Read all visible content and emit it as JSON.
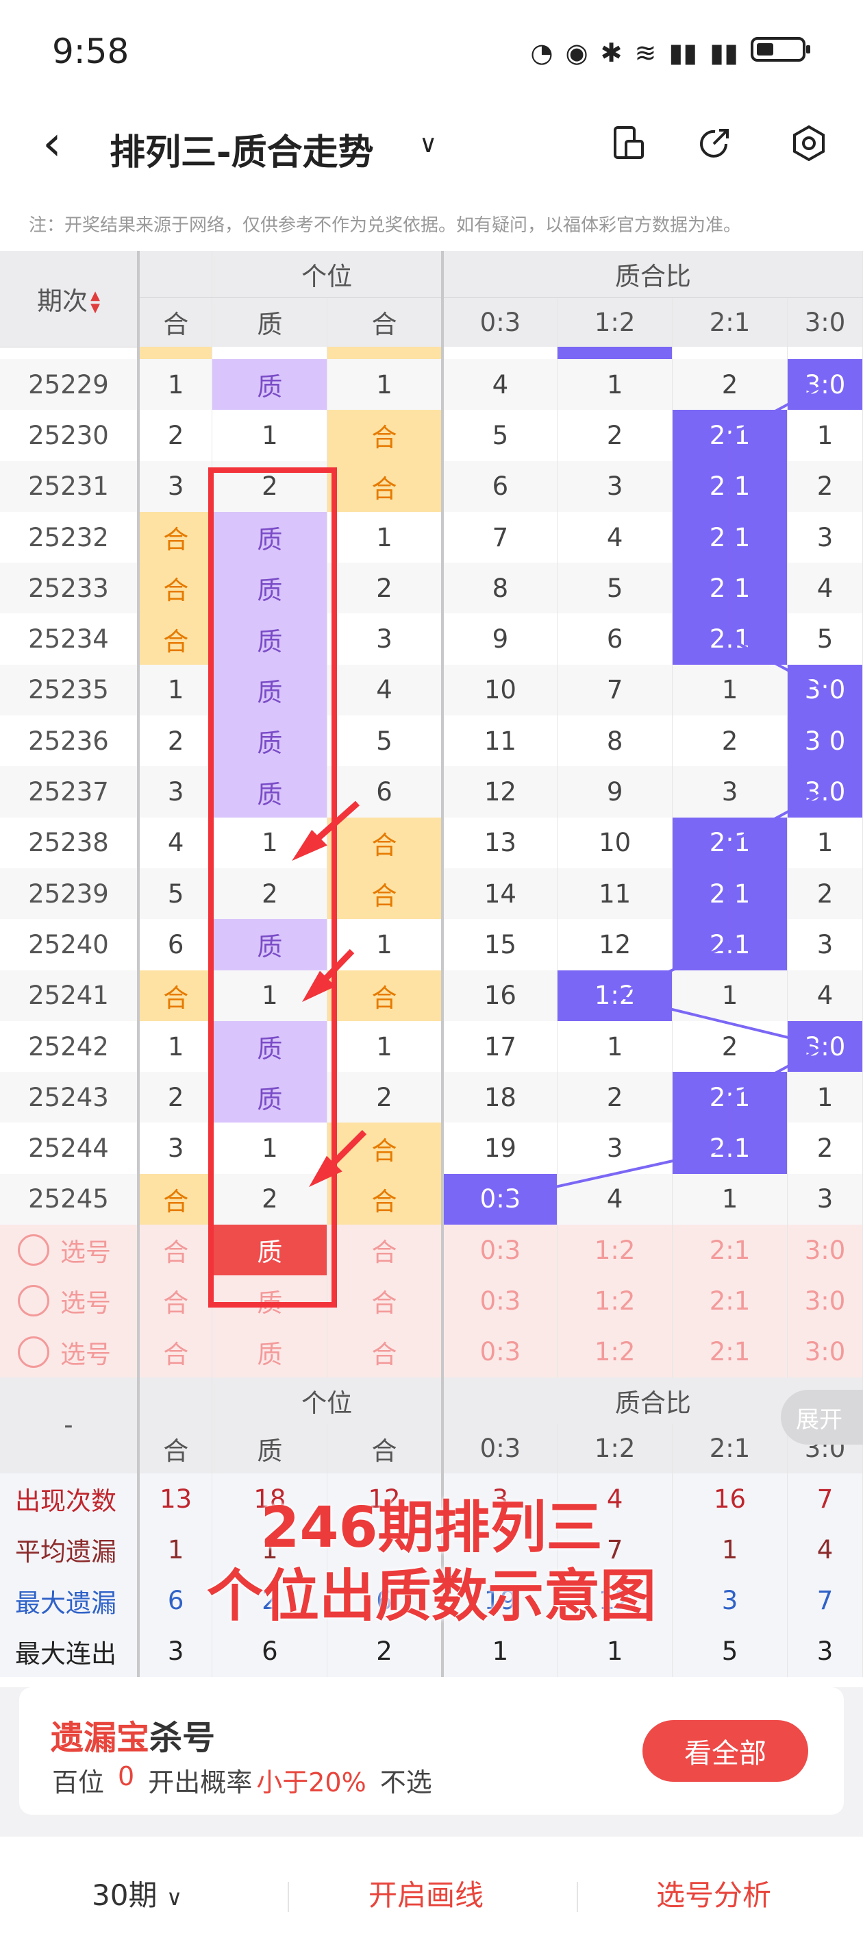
{
  "status_bar": {
    "time": "9:58"
  },
  "header": {
    "title": "排列三-质合走势"
  },
  "notice": "注：开奖结果来源于网络，仅供参考不作为兑奖依据。如有疑问，以福体彩官方数据为准。",
  "table": {
    "period_header": "期次",
    "group_ones": "个位",
    "group_ratio": "质合比",
    "sub_headers": [
      "合",
      "质",
      "合",
      "0:3",
      "1:2",
      "2:1",
      "3:0"
    ],
    "rows": [
      {
        "p": "25229",
        "c": [
          "1",
          "质",
          "1",
          "4",
          "1",
          "2",
          "3:0"
        ],
        "hl": [
          0,
          2,
          0,
          0,
          0,
          0,
          1
        ]
      },
      {
        "p": "25230",
        "c": [
          "2",
          "1",
          "合",
          "5",
          "2",
          "2:1",
          "1"
        ],
        "hl": [
          0,
          0,
          1,
          0,
          0,
          1,
          0
        ]
      },
      {
        "p": "25231",
        "c": [
          "3",
          "2",
          "合",
          "6",
          "3",
          "2:1",
          "2"
        ],
        "hl": [
          0,
          0,
          1,
          0,
          0,
          1,
          0
        ]
      },
      {
        "p": "25232",
        "c": [
          "合",
          "质",
          "1",
          "7",
          "4",
          "2:1",
          "3"
        ],
        "hl": [
          1,
          2,
          0,
          0,
          0,
          1,
          0
        ]
      },
      {
        "p": "25233",
        "c": [
          "合",
          "质",
          "2",
          "8",
          "5",
          "2:1",
          "4"
        ],
        "hl": [
          1,
          2,
          0,
          0,
          0,
          1,
          0
        ]
      },
      {
        "p": "25234",
        "c": [
          "合",
          "质",
          "3",
          "9",
          "6",
          "2:1",
          "5"
        ],
        "hl": [
          1,
          2,
          0,
          0,
          0,
          1,
          0
        ]
      },
      {
        "p": "25235",
        "c": [
          "1",
          "质",
          "4",
          "10",
          "7",
          "1",
          "3:0"
        ],
        "hl": [
          0,
          2,
          0,
          0,
          0,
          0,
          1
        ]
      },
      {
        "p": "25236",
        "c": [
          "2",
          "质",
          "5",
          "11",
          "8",
          "2",
          "3:0"
        ],
        "hl": [
          0,
          2,
          0,
          0,
          0,
          0,
          1
        ]
      },
      {
        "p": "25237",
        "c": [
          "3",
          "质",
          "6",
          "12",
          "9",
          "3",
          "3:0"
        ],
        "hl": [
          0,
          2,
          0,
          0,
          0,
          0,
          1
        ]
      },
      {
        "p": "25238",
        "c": [
          "4",
          "1",
          "合",
          "13",
          "10",
          "2:1",
          "1"
        ],
        "hl": [
          0,
          0,
          1,
          0,
          0,
          1,
          0
        ]
      },
      {
        "p": "25239",
        "c": [
          "5",
          "2",
          "合",
          "14",
          "11",
          "2:1",
          "2"
        ],
        "hl": [
          0,
          0,
          1,
          0,
          0,
          1,
          0
        ]
      },
      {
        "p": "25240",
        "c": [
          "6",
          "质",
          "1",
          "15",
          "12",
          "2:1",
          "3"
        ],
        "hl": [
          0,
          2,
          0,
          0,
          0,
          1,
          0
        ]
      },
      {
        "p": "25241",
        "c": [
          "合",
          "1",
          "合",
          "16",
          "1:2",
          "1",
          "4"
        ],
        "hl": [
          1,
          0,
          1,
          0,
          1,
          0,
          0
        ]
      },
      {
        "p": "25242",
        "c": [
          "1",
          "质",
          "1",
          "17",
          "1",
          "2",
          "3:0"
        ],
        "hl": [
          0,
          2,
          0,
          0,
          0,
          0,
          1
        ]
      },
      {
        "p": "25243",
        "c": [
          "2",
          "质",
          "2",
          "18",
          "2",
          "2:1",
          "1"
        ],
        "hl": [
          0,
          2,
          0,
          0,
          0,
          1,
          0
        ]
      },
      {
        "p": "25244",
        "c": [
          "3",
          "1",
          "合",
          "19",
          "3",
          "2:1",
          "2"
        ],
        "hl": [
          0,
          0,
          1,
          0,
          0,
          1,
          0
        ]
      },
      {
        "p": "25245",
        "c": [
          "合",
          "2",
          "合",
          "0:3",
          "4",
          "1",
          "3"
        ],
        "hl": [
          1,
          0,
          1,
          1,
          0,
          0,
          0
        ]
      }
    ],
    "pick_label": "选号",
    "pick_rows": [
      {
        "c": [
          "合",
          "质",
          "合",
          "0:3",
          "1:2",
          "2:1",
          "3:0"
        ],
        "selected": 1
      },
      {
        "c": [
          "合",
          "质",
          "合",
          "0:3",
          "1:2",
          "2:1",
          "3:0"
        ],
        "selected": -1
      },
      {
        "c": [
          "合",
          "质",
          "合",
          "0:3",
          "1:2",
          "2:1",
          "3:0"
        ],
        "selected": -1
      }
    ],
    "stats_dash": "-",
    "stats": [
      {
        "label": "出现次数",
        "v": [
          "13",
          "18",
          "12",
          "3",
          "4",
          "16",
          "7"
        ],
        "color": "red"
      },
      {
        "label": "平均遗漏",
        "v": [
          "1",
          "1",
          "",
          "",
          "7",
          "1",
          "4"
        ],
        "color": "darkred"
      },
      {
        "label": "最大遗漏",
        "v": [
          "6",
          "2",
          "6",
          "19",
          "12",
          "3",
          "7"
        ],
        "color": "blue"
      },
      {
        "label": "最大连出",
        "v": [
          "3",
          "6",
          "2",
          "1",
          "1",
          "5",
          "3"
        ],
        "color": "dark"
      }
    ],
    "expand_label": "展开"
  },
  "annotation": {
    "line1": "246期排列三",
    "line2": "个位出质数示意图"
  },
  "card": {
    "title_red": "遗漏宝",
    "title_rest": "杀号",
    "position": "百位",
    "number": "0",
    "prob_label": "开出概率",
    "prob_value": "小于20%",
    "advice": "不选",
    "button": "看全部"
  },
  "bottom": {
    "periods": "30期",
    "draw": "开启画线",
    "analysis": "选号分析"
  },
  "colors": {
    "accent": "#e8453c",
    "purple": "#7b67f5",
    "he": "#fde2a4",
    "zhi": "#d9c5fb"
  }
}
